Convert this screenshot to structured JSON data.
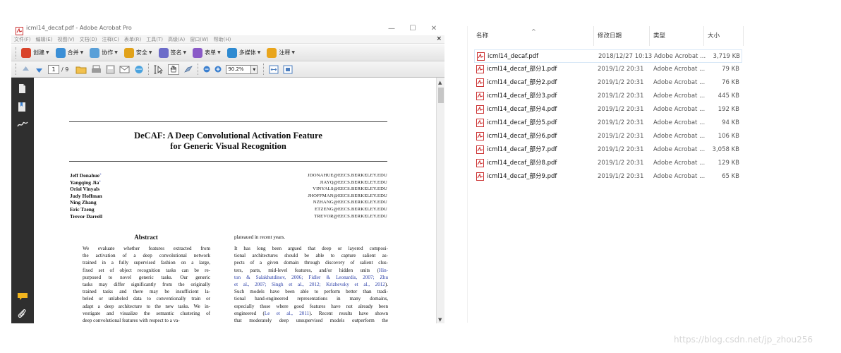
{
  "acrobat": {
    "title": "icml14_decaf.pdf - Adobe Acrobat Pro",
    "window_controls": [
      "—",
      "☐",
      "✕"
    ],
    "menus": [
      "文件(F)",
      "编辑(E)",
      "视图(V)",
      "文档(D)",
      "注释(C)",
      "表单(R)",
      "工具(T)",
      "高级(A)",
      "窗口(W)",
      "帮助(H)"
    ],
    "menu_close": "×",
    "toolbar1": [
      {
        "label": "创建",
        "icon": "create-icon",
        "color": "#d9442b"
      },
      {
        "label": "合并",
        "icon": "combine-icon",
        "color": "#3b8fd6"
      },
      {
        "label": "协作",
        "icon": "collaborate-icon",
        "color": "#5aa0d8"
      },
      {
        "label": "安全",
        "icon": "lock-icon",
        "color": "#e1a21a"
      },
      {
        "label": "签名",
        "icon": "pen-icon",
        "color": "#6c6cc9"
      },
      {
        "label": "表单",
        "icon": "form-icon",
        "color": "#8a5ac7"
      },
      {
        "label": "多媒体",
        "icon": "multimedia-icon",
        "color": "#2e8ad1"
      },
      {
        "label": "注释",
        "icon": "comment-icon",
        "color": "#e9a51c"
      }
    ],
    "page_current": "1",
    "page_total": "/ 9",
    "zoom": "90.2%",
    "colors": {
      "sidepanel": "#2f2f2f",
      "accent": "#2b3fa8"
    }
  },
  "paper": {
    "title_line1": "DeCAF: A Deep Convolutional Activation Feature",
    "title_line2": "for Generic Visual Recognition",
    "authors": [
      "Jeff Donahue",
      "Yangqing Jia",
      "Oriol Vinyals",
      "Judy Hoffman",
      "Ning Zhang",
      "Eric Tzeng",
      "Trevor Darrell"
    ],
    "author_mark": "*",
    "emails": [
      "JDONAHUE@EECS.BERKELEY.EDU",
      "JIAYQ@EECS.BERKELEY.EDU",
      "VINYALS@EECS.BERKELEY.EDU",
      "JHOFFMAN@EECS.BERKELEY.EDU",
      "NZHANG@EECS.BERKELEY.EDU",
      "ETZENG@EECS.BERKELEY.EDU",
      "TREVOR@EECS.BERKELEY.EDU"
    ],
    "abstract_heading": "Abstract",
    "abstract_lines": [
      "We evaluate whether features extracted from",
      "the activation of a deep convolutional network",
      "trained in a fully supervised fashion on a large,",
      "fixed set of object recognition tasks can be re-",
      "purposed to novel generic tasks.  Our generic",
      "tasks may differ significantly from the originally",
      "trained tasks and there may be insufficient la-",
      "beled or unlabeled data to conventionally train or",
      "adapt a deep architecture to the new tasks. We in-",
      "vestigate and visualize the semantic clustering of",
      "deep convolutional features with respect to a va-"
    ],
    "col2_top": "plateaued in recent years.",
    "col2_lines": [
      {
        "t": "It has long been argued that deep or layered composi-"
      },
      {
        "t": "tional architectures should be able to capture salient as-"
      },
      {
        "t": "pects of a given domain through discovery of salient clus-"
      },
      {
        "t": "ters, parts, mid-level features, and/or hidden units (",
        "c": "Hin-"
      },
      {
        "c": "ton & Salakhutdinov, 2006; Fidler & Leonardis, 2007; Zhu"
      },
      {
        "c": "et al., 2007; Singh et al., 2012; Krizhevsky et al., 2012",
        "t2": ")."
      },
      {
        "t": "Such models have been able to perform better than tradi-"
      },
      {
        "t": "tional hand-engineered representations in many domains,"
      },
      {
        "t": "especially those where good features have not already been"
      },
      {
        "t": "engineered (",
        "c": "Le et al., 2011",
        "t2": ").  Recent results have shown"
      },
      {
        "t": "that moderately deep unsupervised models outperform the"
      }
    ]
  },
  "explorer": {
    "columns": {
      "name": "名称",
      "date": "修改日期",
      "type": "类型",
      "size": "大小"
    },
    "sort_indicator": "^",
    "files": [
      {
        "name": "icml14_decaf.pdf",
        "date": "2018/12/27 10:13",
        "type": "Adobe Acrobat ...",
        "size": "3,719 KB",
        "selected": true
      },
      {
        "name": "icml14_decaf_部分1.pdf",
        "date": "2019/1/2 20:31",
        "type": "Adobe Acrobat ...",
        "size": "79 KB"
      },
      {
        "name": "icml14_decaf_部分2.pdf",
        "date": "2019/1/2 20:31",
        "type": "Adobe Acrobat ...",
        "size": "76 KB"
      },
      {
        "name": "icml14_decaf_部分3.pdf",
        "date": "2019/1/2 20:31",
        "type": "Adobe Acrobat ...",
        "size": "445 KB"
      },
      {
        "name": "icml14_decaf_部分4.pdf",
        "date": "2019/1/2 20:31",
        "type": "Adobe Acrobat ...",
        "size": "192 KB"
      },
      {
        "name": "icml14_decaf_部分5.pdf",
        "date": "2019/1/2 20:31",
        "type": "Adobe Acrobat ...",
        "size": "94 KB"
      },
      {
        "name": "icml14_decaf_部分6.pdf",
        "date": "2019/1/2 20:31",
        "type": "Adobe Acrobat ...",
        "size": "106 KB"
      },
      {
        "name": "icml14_decaf_部分7.pdf",
        "date": "2019/1/2 20:31",
        "type": "Adobe Acrobat ...",
        "size": "3,058 KB"
      },
      {
        "name": "icml14_decaf_部分8.pdf",
        "date": "2019/1/2 20:31",
        "type": "Adobe Acrobat ...",
        "size": "129 KB"
      },
      {
        "name": "icml14_decaf_部分9.pdf",
        "date": "2019/1/2 20:31",
        "type": "Adobe Acrobat ...",
        "size": "65 KB"
      }
    ]
  },
  "watermark": "https://blog.csdn.net/jp_zhou256"
}
